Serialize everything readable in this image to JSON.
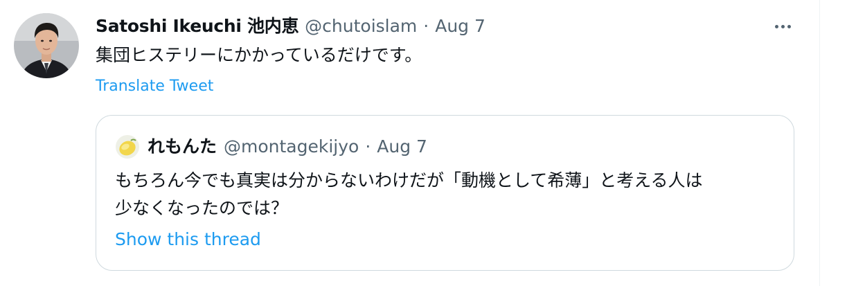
{
  "tweet": {
    "author_name": "Satoshi Ikeuchi 池内恵",
    "author_handle": "@chutoislam",
    "separator": "·",
    "date": "Aug 7",
    "text": "集団ヒステリーにかかっているだけです。",
    "translate_label": "Translate Tweet",
    "more_icon": "more-horizontal-icon"
  },
  "quote": {
    "author_name": "れもんた",
    "author_handle": "@montagekijyo",
    "separator": "·",
    "date": "Aug 7",
    "text_line1": "もちろん今でも真実は分からないわけだが「動機として希薄」と考える人は",
    "text_line2": "少なくなったのでは？",
    "show_thread_label": "Show this thread"
  },
  "colors": {
    "text_primary": "#0f1419",
    "text_secondary": "#536471",
    "link": "#1d9bf0",
    "border": "#cfd9de"
  }
}
